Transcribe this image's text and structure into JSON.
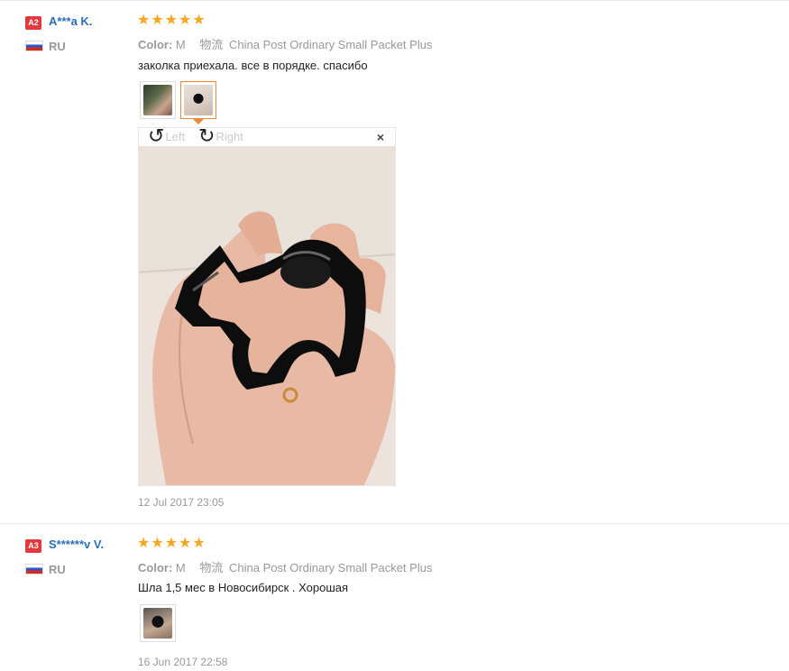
{
  "reviews": [
    {
      "badge": "A2",
      "user": "A***a K.",
      "country": "RU",
      "stars": [
        "★",
        "★",
        "★",
        "★",
        "★"
      ],
      "color_label": "Color:",
      "color_value": "M",
      "ship_icon_char": "物流",
      "shipping": "China Post Ordinary Small Packet Plus",
      "text": "заколка приехала. все в порядке. спасибо",
      "viewer": {
        "left_label": "Left",
        "right_label": "Right",
        "close_char": "×"
      },
      "date": "12 Jul 2017 23:05"
    },
    {
      "badge": "A3",
      "user": "S******v V.",
      "country": "RU",
      "stars": [
        "★",
        "★",
        "★",
        "★",
        "★"
      ],
      "color_label": "Color:",
      "color_value": "M",
      "ship_icon_char": "物流",
      "shipping": "China Post Ordinary Small Packet Plus",
      "text": "Шла 1,5 мес в Новосибирск . Хорошая",
      "date": "16 Jun 2017 22:58"
    }
  ]
}
